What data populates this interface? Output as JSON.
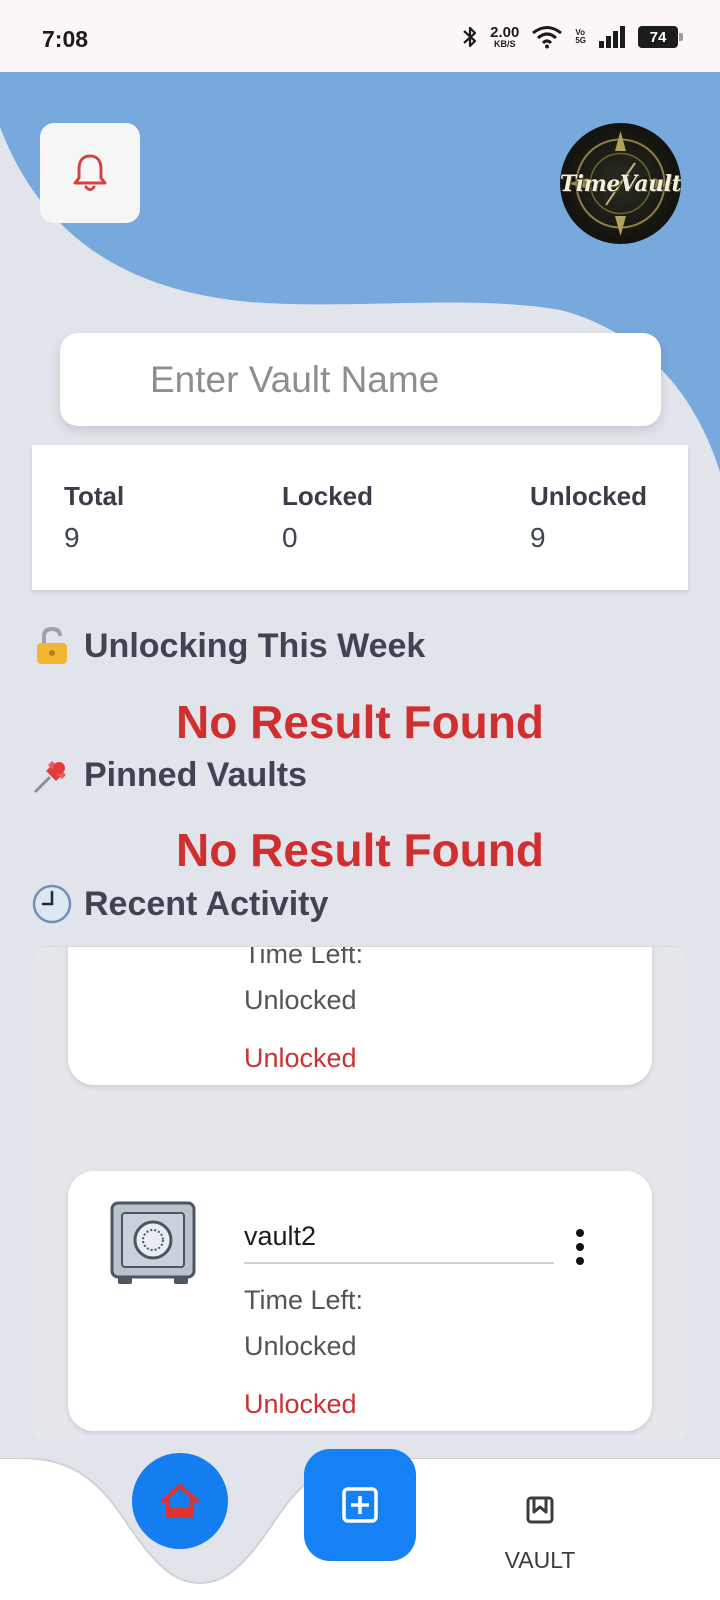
{
  "status_bar": {
    "time": "7:08",
    "speed_value": "2.00",
    "speed_unit": "KB/S",
    "volte_top": "Vo",
    "volte_bottom": "5G",
    "battery": "74"
  },
  "header": {
    "logo_text": "TimeVault",
    "bell_icon": "bell-icon",
    "colors": {
      "header_blue": "#78a9dd",
      "bell_red": "#d94040"
    }
  },
  "search": {
    "placeholder": "Enter Vault Name",
    "value": ""
  },
  "stats": {
    "total_label": "Total",
    "total_value": "9",
    "locked_label": "Locked",
    "locked_value": "0",
    "unlocked_label": "Unlocked",
    "unlocked_value": "9"
  },
  "sections": {
    "unlocking_title": "Unlocking This Week",
    "unlocking_icon": "open-lock-icon",
    "unlocking_empty": "No Result Found",
    "pinned_title": "Pinned Vaults",
    "pinned_icon": "pushpin-icon",
    "pinned_empty": "No Result Found",
    "recent_title": "Recent Activity",
    "recent_icon": "clock-icon"
  },
  "recent_activity": [
    {
      "name": "",
      "time_left_label": "Time Left:",
      "time_left_value": "Unlocked",
      "status": "Unlocked"
    },
    {
      "name": "vault2",
      "time_left_label": "Time Left:",
      "time_left_value": "Unlocked",
      "status": "Unlocked"
    }
  ],
  "nav": {
    "home_icon": "home-icon",
    "add_icon": "plus-square-icon",
    "vault_label": "VAULT",
    "colors": {
      "accent_blue": "#147ef0",
      "home_icon_red": "#e0322e"
    }
  }
}
